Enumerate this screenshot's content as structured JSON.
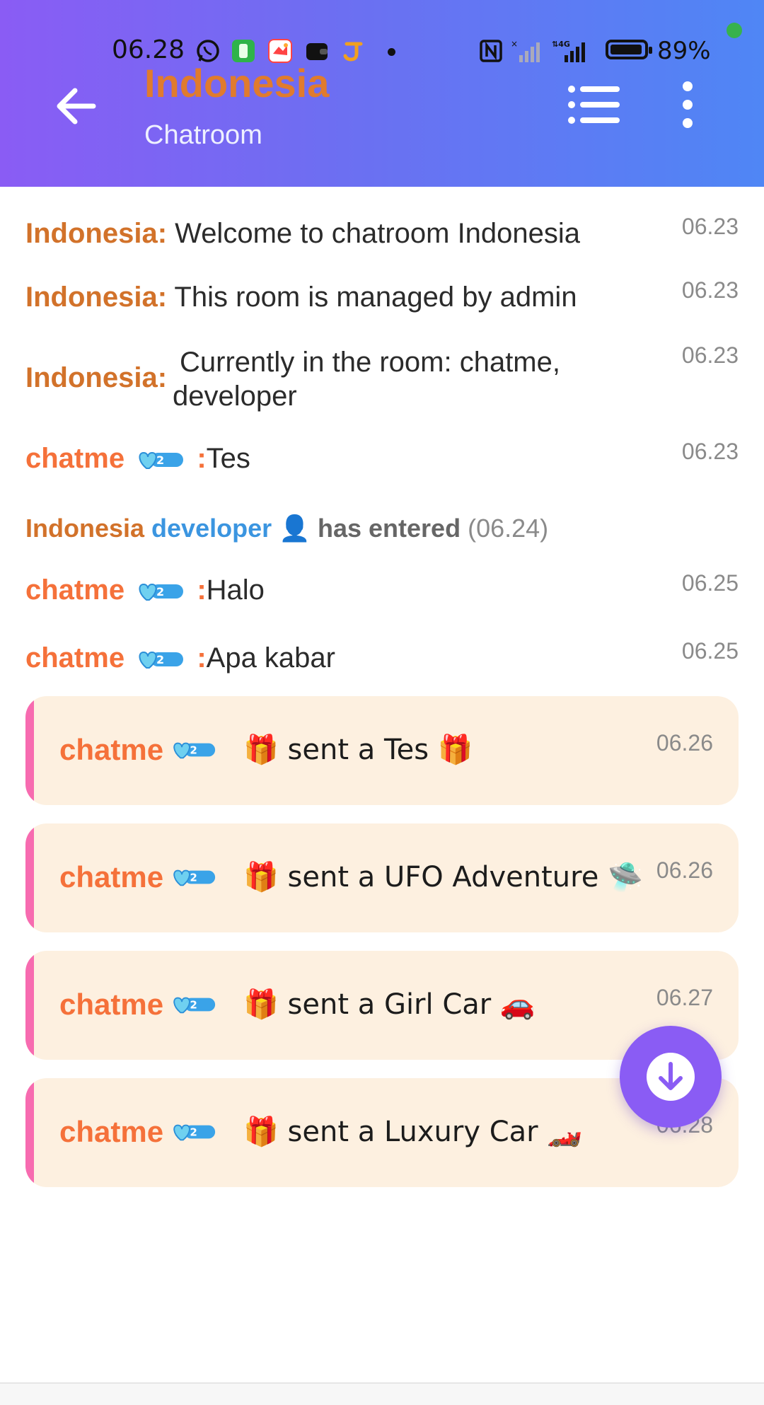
{
  "status_bar": {
    "time": "06.28",
    "battery_percent": "89%",
    "icons": [
      "whatsapp-icon",
      "app-icon-green",
      "game-icon",
      "wallet-icon",
      "app-icon-j",
      "dot-icon",
      "nfc-icon",
      "signal-icon",
      "4g-signal-icon",
      "battery-icon"
    ]
  },
  "header": {
    "title": "Indonesia",
    "subtitle": "Chatroom",
    "back_icon": "arrow-left-icon",
    "list_icon": "list-icon",
    "menu_icon": "more-vertical-icon",
    "gradient": [
      "#8a5cf4",
      "#4f86f5"
    ]
  },
  "messages": [
    {
      "sender": "Indonesia:",
      "text": "Welcome to chatroom Indonesia",
      "time": "06.23"
    },
    {
      "sender": "Indonesia:",
      "text": "This room is managed by admin",
      "time": "06.23"
    },
    {
      "sender": "Indonesia:",
      "text_line1": "Currently in the room: chatme,",
      "text_line2": "developer",
      "time": "06.23"
    },
    {
      "sender": "chatme",
      "separator": ":",
      "text": "Tes",
      "time": "06.23"
    },
    {
      "sender": "chatme",
      "separator": ":",
      "text": "Halo",
      "time": "06.25"
    },
    {
      "sender": "chatme",
      "separator": ":",
      "text": "Apa kabar",
      "time": "06.25"
    }
  ],
  "entered_notice": {
    "room": "Indonesia",
    "user": "developer",
    "person_icon": "👤",
    "text": "has entered",
    "time": "(06.24)"
  },
  "gifts": [
    {
      "sender": "chatme",
      "text": "🎁 sent a Tes 🎁",
      "time": "06.26"
    },
    {
      "sender": "chatme",
      "text": "🎁 sent a UFO Adventure 🛸",
      "time": "06.26"
    },
    {
      "sender": "chatme",
      "text": "🎁 sent a Girl Car 🚗",
      "time": "06.27"
    },
    {
      "sender": "chatme",
      "text": "🎁 sent a Luxury Car 🏎️",
      "time": "06.28"
    }
  ],
  "colors": {
    "system_name": "#d2722a",
    "user_name": "#f5713a",
    "developer": "#3b95e0",
    "gift_bg": "#fdf0e0",
    "gift_bar": "#f76bb0",
    "fab": "#8a5cf4"
  },
  "fab": {
    "icon": "arrow-down-circle-icon"
  }
}
